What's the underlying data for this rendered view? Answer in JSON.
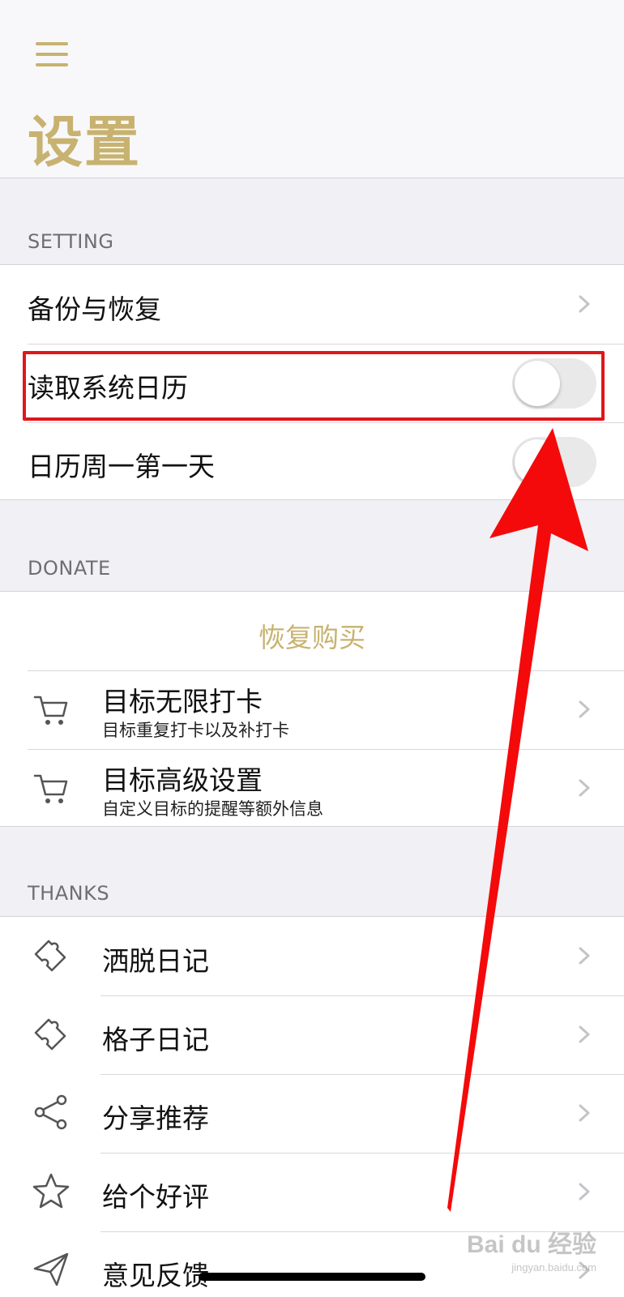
{
  "header": {
    "title": "设置"
  },
  "sections": {
    "setting": {
      "label": "SETTING",
      "items": [
        {
          "label": "备份与恢复",
          "control": "chevron"
        },
        {
          "label": "读取系统日历",
          "control": "toggle",
          "on": false
        },
        {
          "label": "日历周一第一天",
          "control": "toggle",
          "on": false
        }
      ]
    },
    "donate": {
      "label": "DONATE",
      "restore_label": "恢复购买",
      "items": [
        {
          "icon": "cart-icon",
          "title": "目标无限打卡",
          "subtitle": "目标重复打卡以及补打卡"
        },
        {
          "icon": "cart-icon",
          "title": "目标高级设置",
          "subtitle": "自定义目标的提醒等额外信息"
        }
      ]
    },
    "thanks": {
      "label": "THANKS",
      "items": [
        {
          "icon": "puzzle-icon",
          "title": "洒脱日记"
        },
        {
          "icon": "puzzle-icon",
          "title": "格子日记"
        },
        {
          "icon": "share-icon",
          "title": "分享推荐"
        },
        {
          "icon": "star-icon",
          "title": "给个好评"
        },
        {
          "icon": "send-icon",
          "title": "意见反馈"
        }
      ]
    }
  },
  "watermark": {
    "brand": "Bai du 经验",
    "url": "jingyan.baidu.com"
  },
  "colors": {
    "accent": "#c8b270",
    "annotation": "#e0161b",
    "background": "#f0f0f5"
  }
}
